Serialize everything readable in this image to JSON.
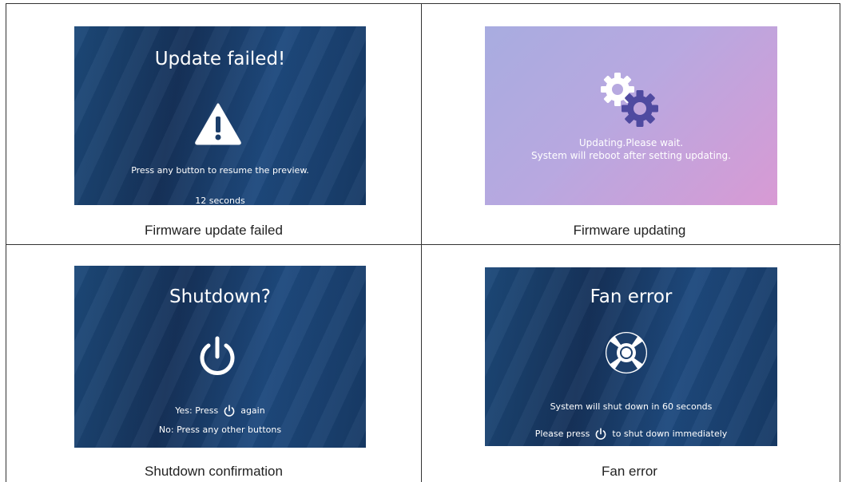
{
  "panels": [
    {
      "title": "Update failed!",
      "message": "Press any button to resume the preview.",
      "countdown": "12 seconds",
      "icon": "warning-icon",
      "caption": "Firmware update failed"
    },
    {
      "line1": "Updating.Please wait.",
      "line2": "System will reboot after setting updating.",
      "icon": "gears-icon",
      "caption": "Firmware updating"
    },
    {
      "title": "Shutdown?",
      "yes_prefix": "Yes: Press",
      "yes_suffix": "again",
      "no_line": "No: Press any other buttons",
      "icon": "power-icon",
      "caption": "Shutdown confirmation"
    },
    {
      "title": "Fan error",
      "line1": "System will shut down in 60 seconds",
      "line2_prefix": "Please press",
      "line2_suffix": "to shut down immediately",
      "icon": "fan-icon",
      "caption": "Fan error"
    }
  ],
  "colors": {
    "screen_blue": "#1d4a7a",
    "screen_purple": "#c0a8e0",
    "text_white": "#ffffff"
  }
}
